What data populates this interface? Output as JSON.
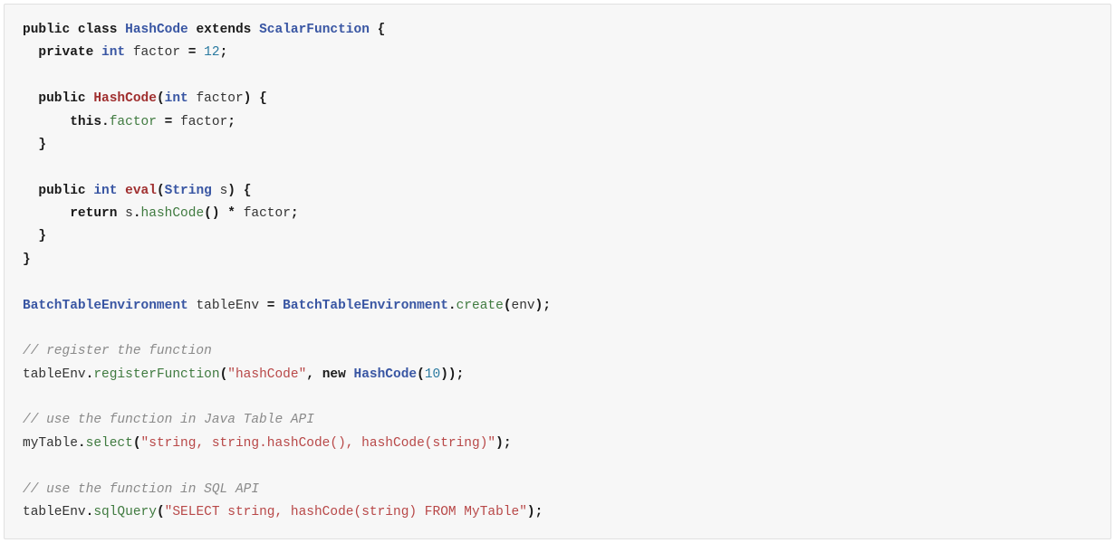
{
  "code": {
    "l01": {
      "a": "public",
      "b": "class",
      "c": "HashCode",
      "d": "extends",
      "e": "ScalarFunction",
      "f": "{"
    },
    "l02": {
      "a": "private",
      "b": "int",
      "c": "factor",
      "d": "=",
      "e": "12",
      "f": ";"
    },
    "l03": {
      "a": "public",
      "b": "HashCode",
      "c": "(",
      "d": "int",
      "e": "factor",
      "f": ")",
      "g": "{"
    },
    "l04": {
      "a": "this",
      "b": ".",
      "c": "factor",
      "d": "=",
      "e": "factor",
      "f": ";"
    },
    "l05": {
      "a": "}"
    },
    "l06": {
      "a": "public",
      "b": "int",
      "c": "eval",
      "d": "(",
      "e": "String",
      "f": "s",
      "g": ")",
      "h": "{"
    },
    "l07": {
      "a": "return",
      "b": "s",
      "c": ".",
      "d": "hashCode",
      "e": "()",
      "f": "*",
      "g": "factor",
      "h": ";"
    },
    "l08": {
      "a": "}"
    },
    "l09": {
      "a": "}"
    },
    "l10": {
      "a": "BatchTableEnvironment",
      "b": "tableEnv",
      "c": "=",
      "d": "BatchTableEnvironment",
      "e": ".",
      "f": "create",
      "g": "(",
      "h": "env",
      "i": ");"
    },
    "l11": {
      "a": "// register the function"
    },
    "l12": {
      "a": "tableEnv",
      "b": ".",
      "c": "registerFunction",
      "d": "(",
      "e": "\"hashCode\"",
      "f": ",",
      "g": "new",
      "h": "HashCode",
      "i": "(",
      "j": "10",
      "k": "));"
    },
    "l13": {
      "a": "// use the function in Java Table API"
    },
    "l14": {
      "a": "myTable",
      "b": ".",
      "c": "select",
      "d": "(",
      "e": "\"string, string.hashCode(), hashCode(string)\"",
      "f": ");"
    },
    "l15": {
      "a": "// use the function in SQL API"
    },
    "l16": {
      "a": "tableEnv",
      "b": ".",
      "c": "sqlQuery",
      "d": "(",
      "e": "\"SELECT string, hashCode(string) FROM MyTable\"",
      "f": ");"
    }
  }
}
